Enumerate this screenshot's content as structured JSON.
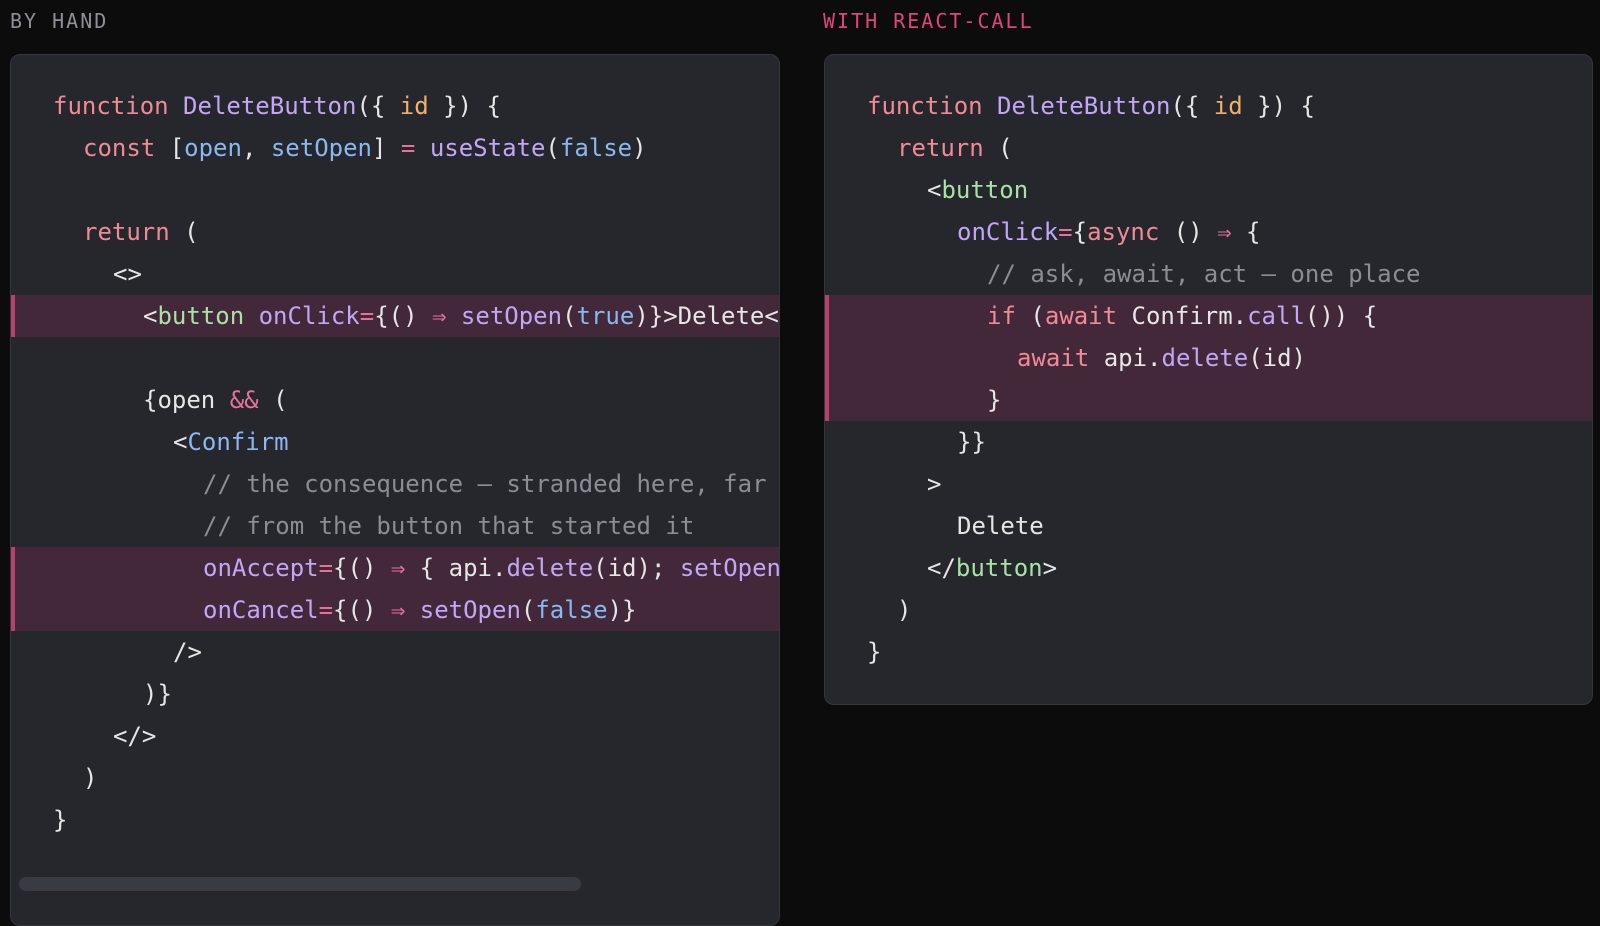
{
  "labels": {
    "left": "BY HAND",
    "right": "WITH REACT-CALL"
  },
  "colors": {
    "background": "#0c0c0d",
    "panel": "#25272d",
    "highlight": "#43283a",
    "highlight_bar": "#b8406d",
    "accent_label": "#e0457a",
    "keyword": "#f08a96",
    "function": "#c3a6f5",
    "param": "#f0b06a",
    "variable": "#8ab8f0",
    "tag": "#a8e2a4",
    "comment": "#8a8d93"
  },
  "left_code": [
    {
      "indent": 0,
      "hl": false,
      "tokens": [
        [
          "function ",
          "kw"
        ],
        [
          "DeleteButton",
          "fn"
        ],
        [
          "({ ",
          "pl"
        ],
        [
          "id",
          "par"
        ],
        [
          " }) {",
          "pl"
        ]
      ]
    },
    {
      "indent": 1,
      "hl": false,
      "tokens": [
        [
          "const ",
          "kw"
        ],
        [
          "[",
          "pl"
        ],
        [
          "open",
          "var"
        ],
        [
          ", ",
          "pl"
        ],
        [
          "setOpen",
          "var"
        ],
        [
          "] ",
          "pl"
        ],
        [
          "= ",
          "op"
        ],
        [
          "useState",
          "fn"
        ],
        [
          "(",
          "pl"
        ],
        [
          "false",
          "var"
        ],
        [
          ")",
          "pl"
        ]
      ]
    },
    {
      "indent": 0,
      "hl": false,
      "tokens": []
    },
    {
      "indent": 1,
      "hl": false,
      "tokens": [
        [
          "return ",
          "kw"
        ],
        [
          "(",
          "pl"
        ]
      ]
    },
    {
      "indent": 2,
      "hl": false,
      "tokens": [
        [
          "<>",
          "pl"
        ]
      ]
    },
    {
      "indent": 3,
      "hl": true,
      "tokens": [
        [
          "<",
          "pl"
        ],
        [
          "button ",
          "tag"
        ],
        [
          "onClick",
          "fn"
        ],
        [
          "=",
          "op"
        ],
        [
          "{() ",
          "pl"
        ],
        [
          "⇒ ",
          "op"
        ],
        [
          "setOpen",
          "fn"
        ],
        [
          "(",
          "pl"
        ],
        [
          "true",
          "var"
        ],
        [
          ")}>Delete</button>",
          "pl"
        ]
      ]
    },
    {
      "indent": 0,
      "hl": false,
      "tokens": []
    },
    {
      "indent": 3,
      "hl": false,
      "tokens": [
        [
          "{open ",
          "pl"
        ],
        [
          "&& ",
          "op"
        ],
        [
          "(",
          "pl"
        ]
      ]
    },
    {
      "indent": 4,
      "hl": false,
      "tokens": [
        [
          "<",
          "pl"
        ],
        [
          "Confirm",
          "var"
        ]
      ]
    },
    {
      "indent": 5,
      "hl": false,
      "tokens": [
        [
          "// the consequence — stranded here, far",
          "cm"
        ]
      ]
    },
    {
      "indent": 5,
      "hl": false,
      "tokens": [
        [
          "// from the button that started it",
          "cm"
        ]
      ]
    },
    {
      "indent": 5,
      "hl": true,
      "tokens": [
        [
          "onAccept",
          "fn"
        ],
        [
          "=",
          "op"
        ],
        [
          "{() ",
          "pl"
        ],
        [
          "⇒ ",
          "op"
        ],
        [
          "{ api.",
          "pl"
        ],
        [
          "delete",
          "fn"
        ],
        [
          "(id); ",
          "pl"
        ],
        [
          "setOpen(false) }}",
          "fn"
        ]
      ]
    },
    {
      "indent": 5,
      "hl": true,
      "tokens": [
        [
          "onCancel",
          "fn"
        ],
        [
          "=",
          "op"
        ],
        [
          "{() ",
          "pl"
        ],
        [
          "⇒ ",
          "op"
        ],
        [
          "setOpen",
          "fn"
        ],
        [
          "(",
          "pl"
        ],
        [
          "false",
          "var"
        ],
        [
          ")}",
          "pl"
        ]
      ]
    },
    {
      "indent": 4,
      "hl": false,
      "tokens": [
        [
          "/>",
          "pl"
        ]
      ]
    },
    {
      "indent": 3,
      "hl": false,
      "tokens": [
        [
          ")}",
          "pl"
        ]
      ]
    },
    {
      "indent": 2,
      "hl": false,
      "tokens": [
        [
          "</>",
          "pl"
        ]
      ]
    },
    {
      "indent": 1,
      "hl": false,
      "tokens": [
        [
          ")",
          "pl"
        ]
      ]
    },
    {
      "indent": 0,
      "hl": false,
      "tokens": [
        [
          "}",
          "pl"
        ]
      ]
    }
  ],
  "right_code": [
    {
      "indent": 0,
      "hl": false,
      "tokens": [
        [
          "function ",
          "kw"
        ],
        [
          "DeleteButton",
          "fn"
        ],
        [
          "({ ",
          "pl"
        ],
        [
          "id",
          "par"
        ],
        [
          " }) {",
          "pl"
        ]
      ]
    },
    {
      "indent": 1,
      "hl": false,
      "tokens": [
        [
          "return ",
          "kw"
        ],
        [
          "(",
          "pl"
        ]
      ]
    },
    {
      "indent": 2,
      "hl": false,
      "tokens": [
        [
          "<",
          "pl"
        ],
        [
          "button",
          "tag"
        ]
      ]
    },
    {
      "indent": 3,
      "hl": false,
      "tokens": [
        [
          "onClick",
          "fn"
        ],
        [
          "=",
          "op"
        ],
        [
          "{",
          "pl"
        ],
        [
          "async ",
          "kw"
        ],
        [
          "() ",
          "pl"
        ],
        [
          "⇒ ",
          "op"
        ],
        [
          "{",
          "pl"
        ]
      ]
    },
    {
      "indent": 4,
      "hl": false,
      "tokens": [
        [
          "// ask, await, act — one place",
          "cm"
        ]
      ]
    },
    {
      "indent": 4,
      "hl": true,
      "tokens": [
        [
          "if ",
          "kw"
        ],
        [
          "(",
          "pl"
        ],
        [
          "await ",
          "kw"
        ],
        [
          "Confirm.",
          "pl"
        ],
        [
          "call",
          "fn"
        ],
        [
          "()) {",
          "pl"
        ]
      ]
    },
    {
      "indent": 5,
      "hl": true,
      "tokens": [
        [
          "await ",
          "kw"
        ],
        [
          "api.",
          "pl"
        ],
        [
          "delete",
          "fn"
        ],
        [
          "(id)",
          "pl"
        ]
      ]
    },
    {
      "indent": 4,
      "hl": true,
      "tokens": [
        [
          "}",
          "pl"
        ]
      ]
    },
    {
      "indent": 3,
      "hl": false,
      "tokens": [
        [
          "}}",
          "pl"
        ]
      ]
    },
    {
      "indent": 2,
      "hl": false,
      "tokens": [
        [
          ">",
          "pl"
        ]
      ]
    },
    {
      "indent": 3,
      "hl": false,
      "tokens": [
        [
          "Delete",
          "pl"
        ]
      ]
    },
    {
      "indent": 2,
      "hl": false,
      "tokens": [
        [
          "</",
          "pl"
        ],
        [
          "button",
          "tag"
        ],
        [
          ">",
          "pl"
        ]
      ]
    },
    {
      "indent": 1,
      "hl": false,
      "tokens": [
        [
          ")",
          "pl"
        ]
      ]
    },
    {
      "indent": 0,
      "hl": false,
      "tokens": [
        [
          "}",
          "pl"
        ]
      ]
    }
  ]
}
